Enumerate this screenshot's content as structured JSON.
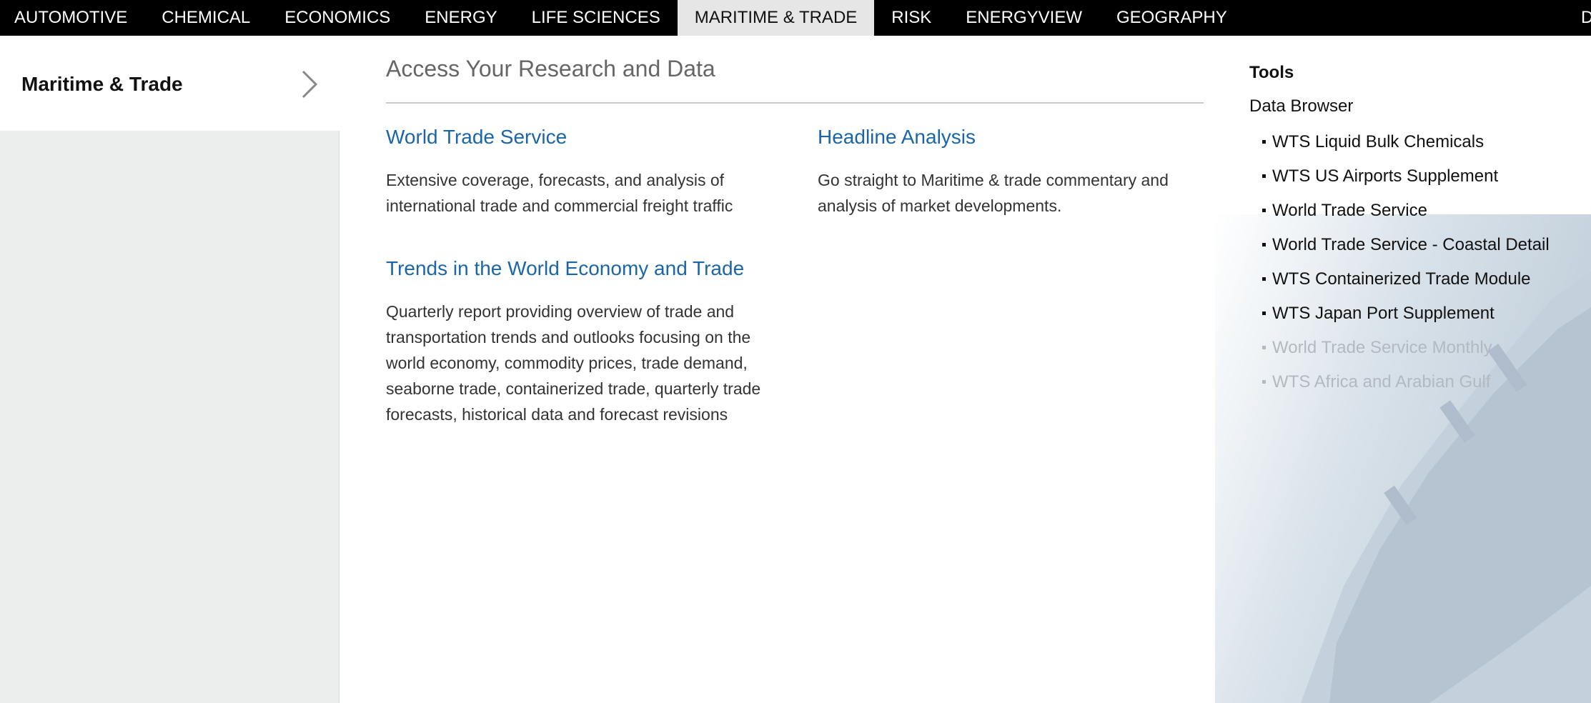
{
  "nav": {
    "items": [
      "AUTOMOTIVE",
      "CHEMICAL",
      "ECONOMICS",
      "ENERGY",
      "LIFE SCIENCES",
      "MARITIME & TRADE",
      "RISK",
      "ENERGYVIEW",
      "GEOGRAPHY"
    ],
    "active": "MARITIME & TRADE",
    "cut_item": "D"
  },
  "left_panel": {
    "title": "Maritime & Trade",
    "chevron_icon": "chevron-right-icon"
  },
  "menu": {
    "heading": "Access Your Research and Data",
    "products": [
      {
        "title": "World Trade Service",
        "description": [
          "Extensive coverage, forecasts, and analysis of",
          "international trade and commercial freight traffic"
        ]
      },
      {
        "title": "Headline Analysis",
        "description": [
          "Go straight to Maritime & trade commentary and",
          "analysis of market developments."
        ]
      },
      {
        "title": "Trends in the World Economy and Trade",
        "description": [
          "Quarterly report providing overview of trade and",
          "transportation trends and outlooks focusing on the",
          "world economy, commodity prices, trade demand,",
          "seaborne trade, containerized trade, quarterly trade",
          "forecasts, historical data and forecast revisions"
        ]
      }
    ]
  },
  "tools": {
    "title": "Tools",
    "data_browser_label": "Data Browser",
    "items": [
      "WTS Liquid Bulk Chemicals",
      "WTS US Airports Supplement",
      "World Trade Service",
      "World Trade Service - Coastal Detail",
      "WTS Containerized Trade Module",
      "WTS Japan Port Supplement",
      "World Trade Service Monthly",
      "WTS Africa and Arabian Gulf"
    ]
  },
  "colors": {
    "nav_bg": "#000000",
    "nav_active_bg": "#e6e6e6",
    "link_blue": "#1a66a8",
    "heading_gray": "#666666"
  }
}
